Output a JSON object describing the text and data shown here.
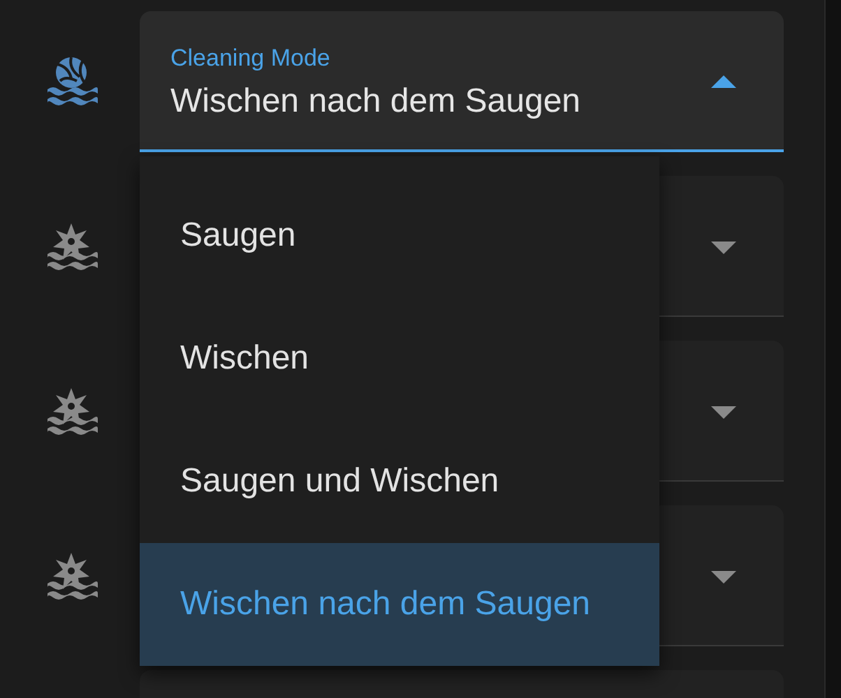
{
  "selects": [
    {
      "kind": "mop",
      "label": "Cleaning Mode",
      "value": "Wischen nach dem Saugen",
      "expanded": true
    },
    {
      "kind": "sun",
      "expanded": false
    },
    {
      "kind": "sun",
      "expanded": false
    },
    {
      "kind": "sun",
      "expanded": false
    }
  ],
  "menu": {
    "options": [
      {
        "label": "Saugen",
        "selected": false
      },
      {
        "label": "Wischen",
        "selected": false
      },
      {
        "label": "Saugen und Wischen",
        "selected": false
      },
      {
        "label": "Wischen nach dem Saugen",
        "selected": true
      }
    ]
  }
}
